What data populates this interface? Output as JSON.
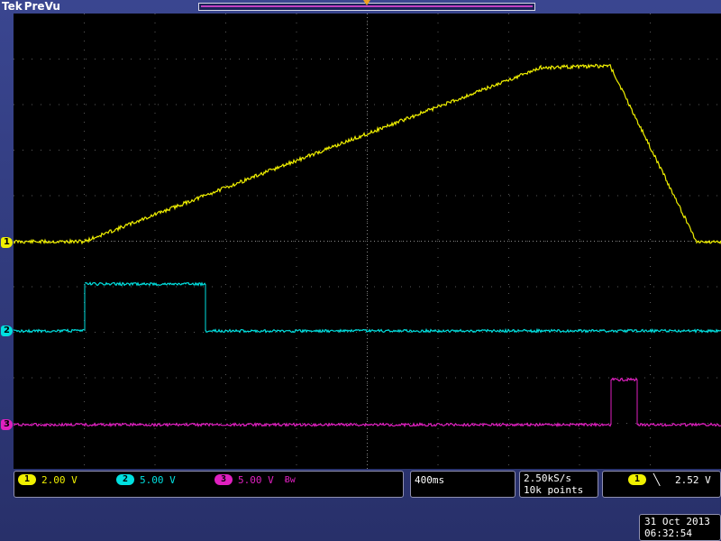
{
  "header": {
    "brand": "Tek",
    "mode": "PreVu"
  },
  "channels": [
    {
      "id": "1",
      "scale": "2.00 V",
      "color": "#f0f000"
    },
    {
      "id": "2",
      "scale": "5.00 V",
      "color": "#00e0e0"
    },
    {
      "id": "3",
      "scale": "5.00 V",
      "color": "#e020c0"
    }
  ],
  "bandwidth_icon": "bw-limit-icon",
  "timebase": "400ms",
  "sampling": {
    "rate": "2.50kS/s",
    "record": "10k points"
  },
  "trigger": {
    "channel": "1",
    "slope_icon": "falling-edge-icon",
    "level": "2.52 V"
  },
  "clock": {
    "date": "31 Oct  2013",
    "time": "06:32:54"
  }
}
